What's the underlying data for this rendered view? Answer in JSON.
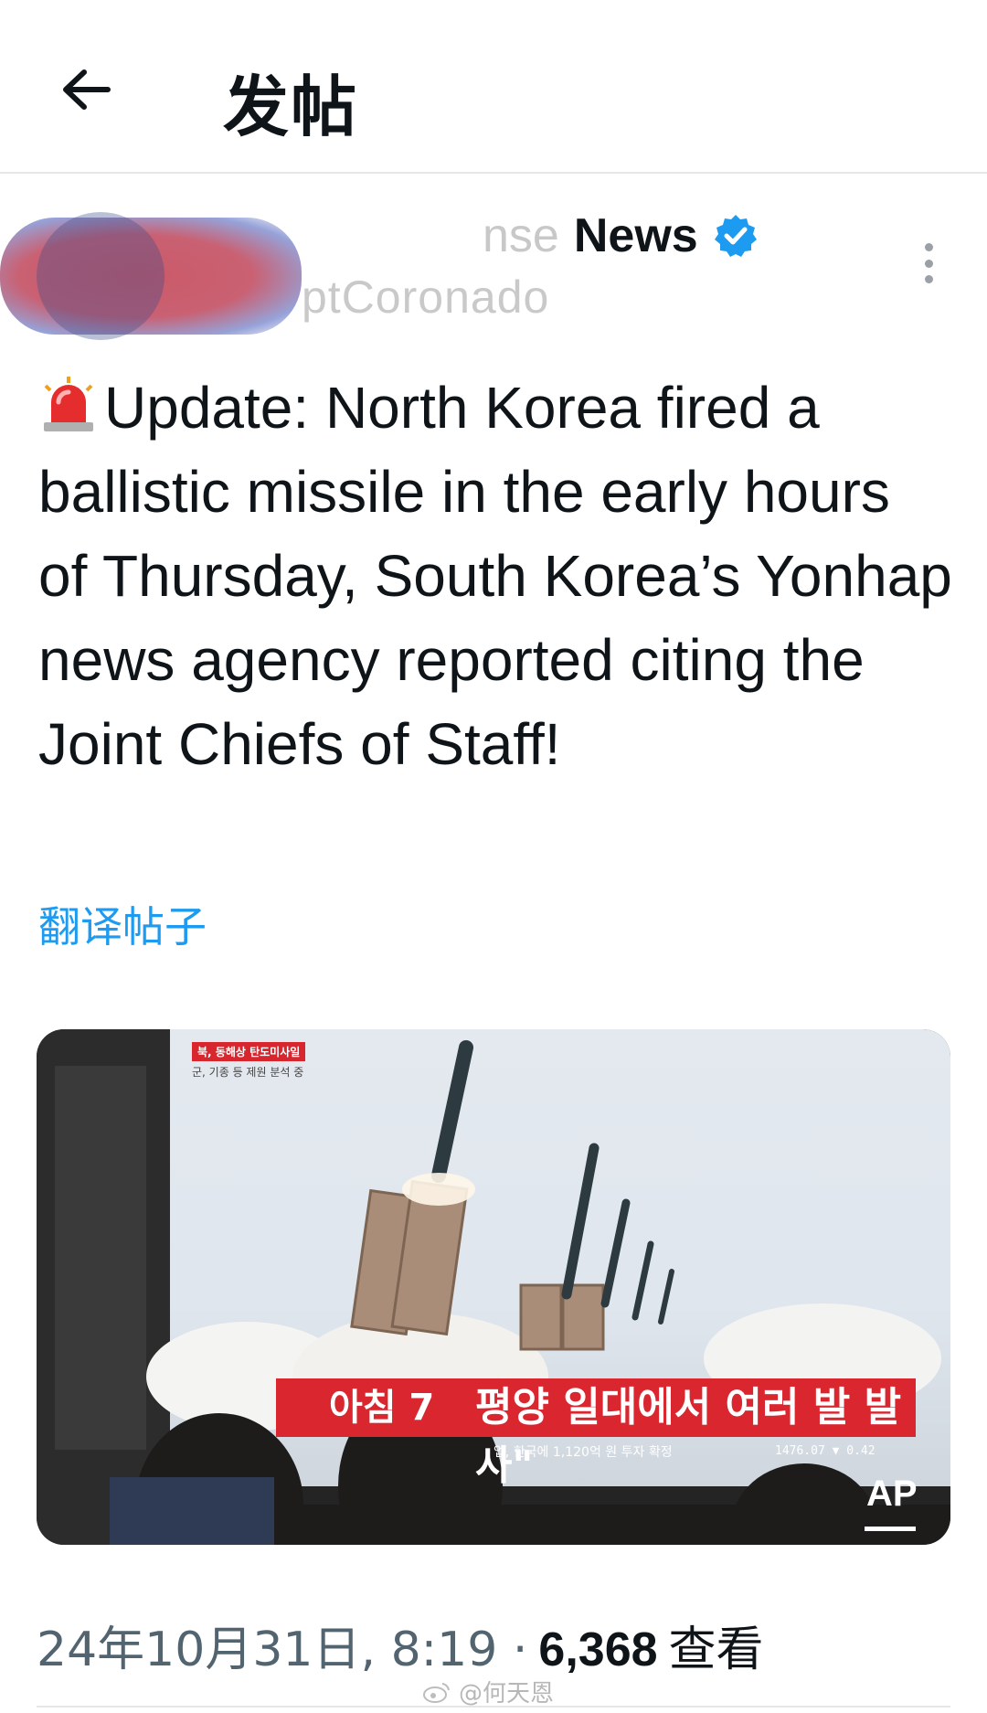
{
  "header": {
    "title": "发帖",
    "back_icon": "arrow-left-icon"
  },
  "author": {
    "display_name_faded": "nse",
    "display_name": "News",
    "handle": "ptCoronado",
    "verified_color": "#1d9bf0"
  },
  "post": {
    "text": "Update: North Korea fired a ballistic missile in the early hours of Thursday, South Korea’s Yonhap news agency reported citing the Joint Chiefs of Staff!",
    "emoji_icon": "police-siren-icon",
    "translate_label": "翻译帖子"
  },
  "media": {
    "tv_caption_top": "북, 동해상 탄도미사일",
    "tv_caption_sub": "군, 기종 등 제원 분석 중",
    "ticker_left": "아침 7",
    "ticker_main": "평양 일대에서 여러 발 발사\"",
    "ticker_sub": "업, 한국에 1,120억 원 투자 확정",
    "ticker_rate": "1476.07 ▼ 0.42",
    "watermark_logo": "AP"
  },
  "meta": {
    "timestamp": "24年10月31日, 8:19 ·",
    "views_count": "6,368",
    "views_label": "查看"
  },
  "watermark": {
    "text": "@何天恩"
  },
  "colors": {
    "link": "#1d9bf0",
    "ticker_red": "#d9262f",
    "secondary_text": "#536471"
  }
}
